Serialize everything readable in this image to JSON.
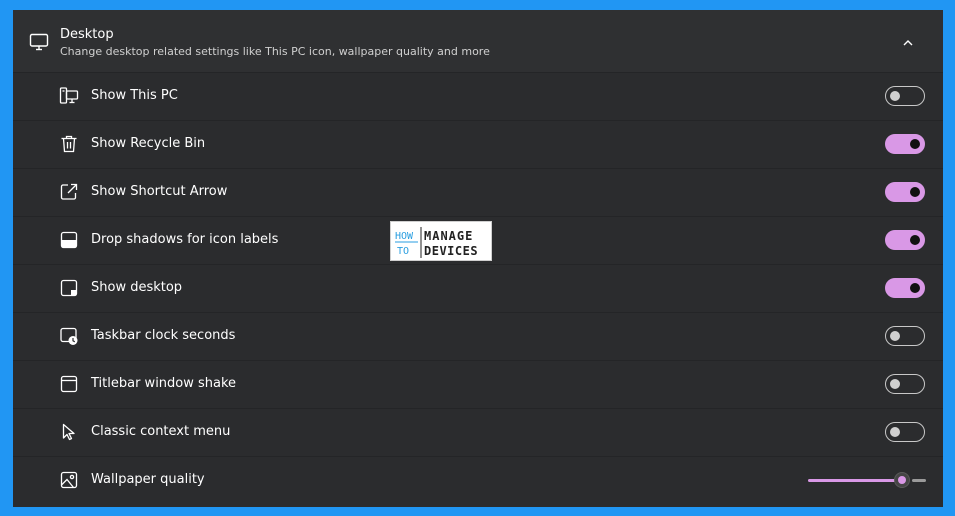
{
  "header": {
    "title": "Desktop",
    "subtitle": "Change desktop related settings like This PC icon, wallpaper quality and more",
    "icon": "monitor-icon",
    "expand_icon": "chevron-up-icon"
  },
  "settings": [
    {
      "label": "Show This PC",
      "icon": "this-pc-icon",
      "control": "toggle",
      "on": false
    },
    {
      "label": "Show Recycle Bin",
      "icon": "recycle-bin-icon",
      "control": "toggle",
      "on": true
    },
    {
      "label": "Show Shortcut Arrow",
      "icon": "shortcut-arrow-icon",
      "control": "toggle",
      "on": true
    },
    {
      "label": "Drop shadows for icon labels",
      "icon": "drop-shadow-icon",
      "control": "toggle",
      "on": true
    },
    {
      "label": "Show desktop",
      "icon": "show-desktop-icon",
      "control": "toggle",
      "on": true
    },
    {
      "label": "Taskbar clock seconds",
      "icon": "clock-seconds-icon",
      "control": "toggle",
      "on": false
    },
    {
      "label": "Titlebar window shake",
      "icon": "window-icon",
      "control": "toggle",
      "on": false
    },
    {
      "label": "Classic context menu",
      "icon": "cursor-icon",
      "control": "toggle",
      "on": false
    },
    {
      "label": "Wallpaper quality",
      "icon": "image-icon",
      "control": "slider",
      "value": 0.8
    }
  ],
  "watermark": {
    "line1a": "HOW",
    "line1b": "MANAGE",
    "line2a": "TO",
    "line2b": "DEVICES"
  },
  "colors": {
    "accent": "#d998e6",
    "panel": "#2b2c2e",
    "background": "#2196f3"
  }
}
